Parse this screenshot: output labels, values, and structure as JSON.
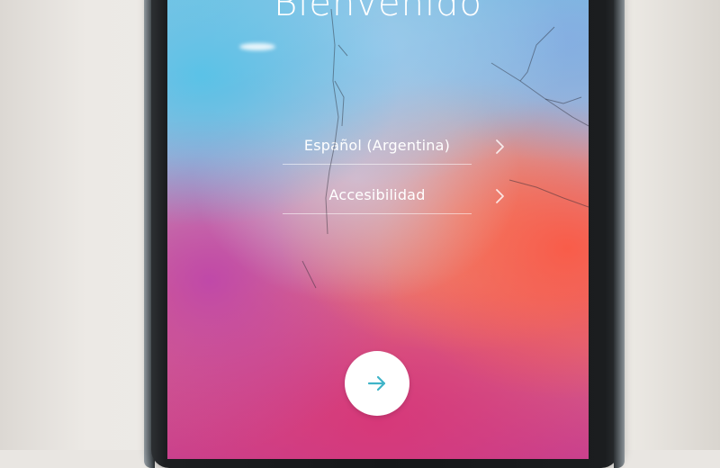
{
  "screen": {
    "title": "Bienvenido",
    "menu": [
      {
        "label": "Español (Argentina)",
        "icon": "chevron-right-icon"
      },
      {
        "label": "Accesibilidad",
        "icon": "chevron-right-icon"
      }
    ],
    "next_button_icon": "arrow-right-icon"
  },
  "colors": {
    "text": "#ffffff",
    "arrow": "#3fb4c8",
    "button_bg": "#ffffff"
  }
}
